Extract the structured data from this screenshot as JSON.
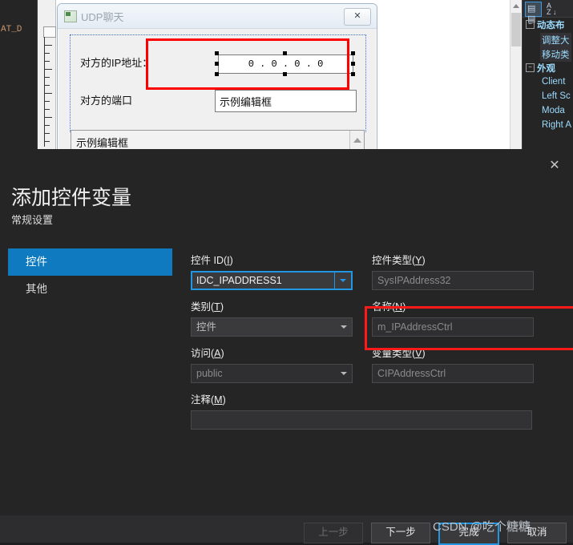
{
  "background": {
    "code_fragment": "AT_D",
    "designer": {
      "window_title": "UDP聊天",
      "window_icon": "app-icon",
      "close_label": "✕",
      "labels": {
        "ip_address": "对方的IP地址：",
        "port": "对方的端口"
      },
      "ip_control_value": "0 . 0 . 0 . 0",
      "ip_octets": [
        "0",
        ".",
        "0",
        ".",
        "0",
        ".",
        "0"
      ],
      "port_edit_value": "示例编辑框",
      "listbox_value": "示例编辑框"
    },
    "properties_panel": {
      "toolbar": [
        {
          "name": "categorized-view",
          "glyph": "▤",
          "selected": true
        },
        {
          "name": "alphabetical-sort",
          "glyph": "A↓",
          "selected": false
        }
      ],
      "rows": [
        {
          "type": "group",
          "label": "动态布"
        },
        {
          "type": "item",
          "label": "调整大"
        },
        {
          "type": "item",
          "label": "移动类"
        },
        {
          "type": "group",
          "label": "外观"
        },
        {
          "type": "item",
          "label": "Client"
        },
        {
          "type": "item",
          "label": "Left Sc"
        },
        {
          "type": "item",
          "label": "Moda"
        },
        {
          "type": "item",
          "label": "Right A"
        }
      ]
    }
  },
  "wizard": {
    "close_label": "✕",
    "title": "添加控件变量",
    "subtitle": "常规设置",
    "nav": [
      {
        "label": "控件",
        "active": true
      },
      {
        "label": "其他",
        "active": false
      }
    ],
    "fields": {
      "control_id": {
        "label": "控件 ID(",
        "accel": "I",
        "label_end": ")",
        "value": "IDC_IPADDRESS1"
      },
      "control_type": {
        "label": "控件类型(",
        "accel": "Y",
        "label_end": ")",
        "value": "SysIPAddress32"
      },
      "category": {
        "label": "类别(",
        "accel": "T",
        "label_end": ")",
        "value": "控件"
      },
      "name": {
        "label": "名称(",
        "accel": "N",
        "label_end": ")",
        "value": "m_IPAddressCtrl"
      },
      "access": {
        "label": "访问(",
        "accel": "A",
        "label_end": ")",
        "value": "public"
      },
      "variable_type": {
        "label": "变量类型(",
        "accel": "V",
        "label_end": ")",
        "value": "CIPAddressCtrl"
      },
      "comment": {
        "label": "注释(",
        "accel": "M",
        "label_end": ")",
        "value": ""
      }
    },
    "buttons": [
      {
        "label": "上一步",
        "state": "disabled"
      },
      {
        "label": "下一步",
        "state": "normal"
      },
      {
        "label": "完成",
        "state": "default"
      },
      {
        "label": "取消",
        "state": "normal"
      }
    ]
  },
  "watermark": "CSDN @吃个糖糖",
  "colors": {
    "accent_blue": "#0f7ac0",
    "focus_blue": "#2196e3",
    "highlight_red": "#ff1a1a",
    "dialog_bg": "#252526",
    "footer_bg": "#2d2d30"
  }
}
